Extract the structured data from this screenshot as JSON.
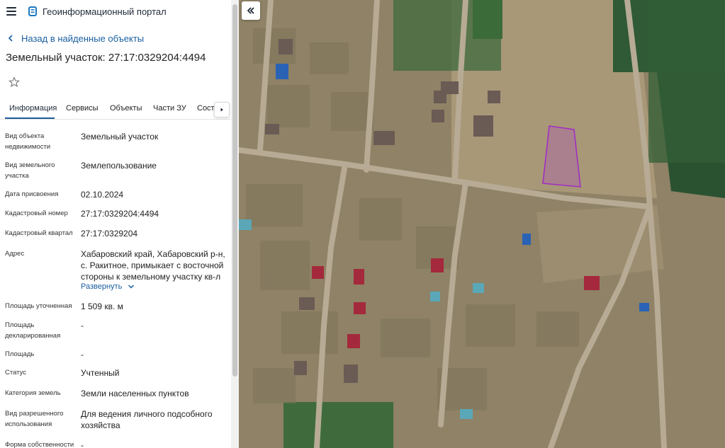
{
  "header": {
    "app_title": "Геоинформационный портал",
    "menu_icon": "hamburger-menu-icon",
    "logo_icon": "portal-logo-icon"
  },
  "nav": {
    "back_label": "Назад в найденные объекты",
    "back_icon": "chevron-left-icon"
  },
  "object": {
    "title": "Земельный участок: 27:17:0329204:4494",
    "favorite_icon": "star-outline-icon"
  },
  "tabs": [
    {
      "label": "Информация",
      "active": true
    },
    {
      "label": "Сервисы",
      "active": false
    },
    {
      "label": "Объекты",
      "active": false
    },
    {
      "label": "Части ЗУ",
      "active": false
    },
    {
      "label": "Соста",
      "active": false
    }
  ],
  "tabs_scroll_icon": "chevron-right-icon",
  "fields": {
    "object_type": {
      "label": "Вид объекта недвижимости",
      "value": "Земельный участок"
    },
    "land_type": {
      "label": "Вид земельного участка",
      "value": "Землепользование"
    },
    "assign_date": {
      "label": "Дата присвоения",
      "value": "02.10.2024"
    },
    "cad_number": {
      "label": "Кадастровый номер",
      "value": "27:17:0329204:4494"
    },
    "cad_quarter": {
      "label": "Кадастровый квартал",
      "value": "27:17:0329204"
    },
    "address": {
      "label": "Адрес",
      "value": "Хабаровский край, Хабаровский р-н, с. Ракитное, примыкает с восточной стороны к земельному участку кв-л",
      "expand_label": "Развернуть",
      "expand_icon": "chevron-down-icon"
    },
    "area_specified": {
      "label": "Площадь уточненная",
      "value": "1 509 кв. м"
    },
    "area_declared": {
      "label": "Площадь декларированная",
      "value": "-"
    },
    "area": {
      "label": "Площадь",
      "value": "-"
    },
    "status": {
      "label": "Статус",
      "value": "Учтенный"
    },
    "land_category": {
      "label": "Категория земель",
      "value": "Земли населенных пунктов"
    },
    "permitted_use": {
      "label": "Вид разрешенного использования",
      "value": "Для ведения личного подсобного хозяйства"
    },
    "ownership": {
      "label": "Форма собственности",
      "value": "-"
    }
  },
  "map": {
    "collapse_icon": "double-chevron-left-icon",
    "highlight_color": "#b040c8",
    "road_color": "#b7ab95"
  }
}
